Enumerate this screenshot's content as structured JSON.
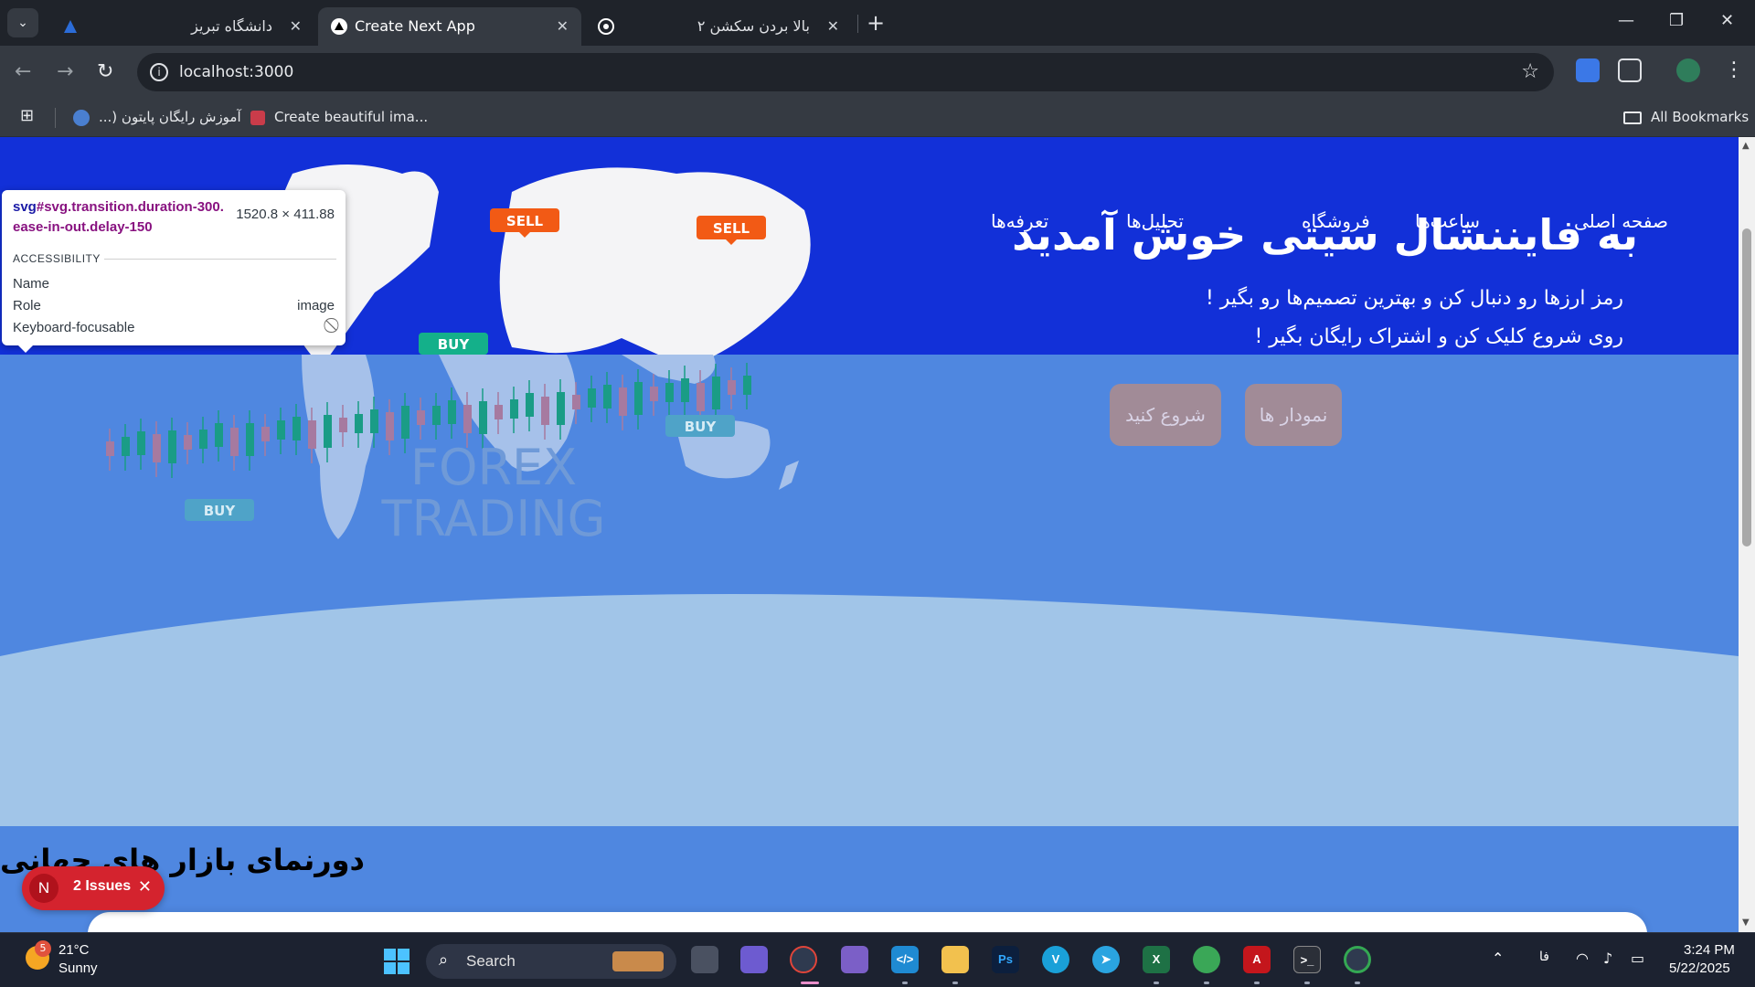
{
  "browser": {
    "tabs": [
      {
        "title": "دانشگاه تبریز",
        "active": false,
        "icon": "university-logo-icon"
      },
      {
        "title": "Create Next App",
        "active": true,
        "icon": "nextjs-triangle-icon"
      },
      {
        "title": "بالا بردن سکشن ۲",
        "active": false,
        "icon": "chatgpt-logo-icon"
      }
    ],
    "url": "localhost:3000",
    "bookmarks": [
      {
        "label": "آموزش رایگان پایتون (...",
        "icon": "python-course-icon"
      },
      {
        "label": "Create beautiful ima...",
        "icon": "image-generator-icon"
      }
    ],
    "all_bookmarks": "All Bookmarks"
  },
  "site": {
    "nav": [
      "صفحه اصلی",
      "ساعت‌ها",
      "فروشگاه",
      "تحلیل‌ها",
      "تعرفه‌ها"
    ],
    "hero_title": "به فایننشال سیتی خوش آمدید",
    "hero_line1": "رمز ارزها رو دنبال کن و بهترین تصمیم‌ها رو بگیر !",
    "hero_line2": "روی شروع کلیک کن و اشتراک رایگان بگیر !",
    "buttons": {
      "charts": "نمودار ها",
      "start": "شروع کنید"
    },
    "illustration": {
      "sell1": "SELL",
      "sell2": "SELL",
      "buy1": "BUY",
      "buy2": "BUY",
      "buy3": "BUY",
      "brand1": "FOREX",
      "brand2": "TRADING"
    },
    "section_title": "دورنمای بازار های جهانی"
  },
  "devtools_tooltip": {
    "tag": "svg",
    "selector": "#svg.transition.duration-300.ease-in-out.delay-150",
    "dimensions": "1520.8 × 411.88",
    "section": "ACCESSIBILITY",
    "rows": [
      {
        "key": "Name",
        "value": ""
      },
      {
        "key": "Role",
        "value": "image"
      },
      {
        "key": "Keyboard-focusable",
        "value": ""
      }
    ]
  },
  "next_issues": {
    "badge": "N",
    "label": "2 Issues"
  },
  "taskbar": {
    "weather_badge": "5",
    "temperature": "21°C",
    "condition": "Sunny",
    "search_placeholder": "Search",
    "language": "فا",
    "time": "3:24 PM",
    "date": "5/22/2025"
  },
  "colors": {
    "hero_dark": "#1230d8",
    "hero_mid": "#4f87e0",
    "hero_light": "#a1c5e8",
    "button_bg": "#a18b97",
    "issues_red": "#d4232e"
  }
}
